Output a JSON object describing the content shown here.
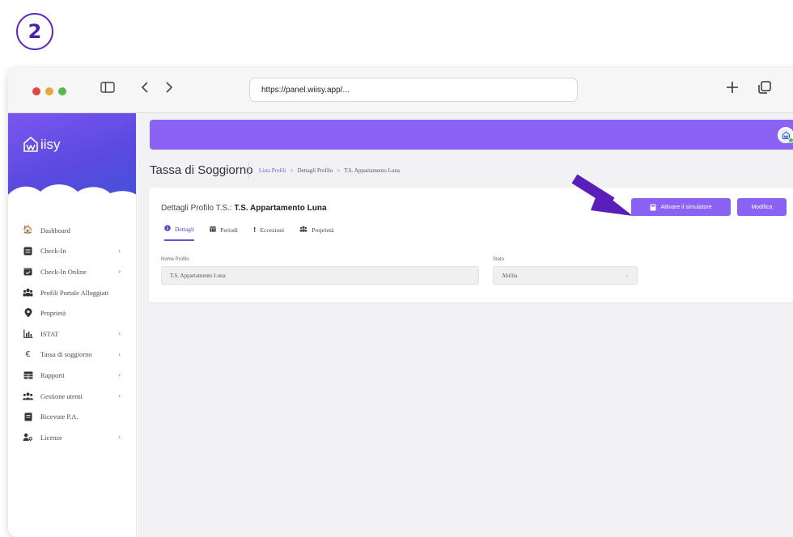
{
  "step": {
    "number": "2"
  },
  "browser": {
    "url": "https://panel.wiisy.app/..."
  },
  "brand": {
    "logo_text": "iisy",
    "accent": "#8a63f5",
    "sidebar_gradient": [
      "#7a57ef",
      "#3f55d8"
    ]
  },
  "sidebar": {
    "items": [
      {
        "label": "Dashboard",
        "icon": "home-icon",
        "chevron": false
      },
      {
        "label": "Check-In",
        "icon": "list-icon",
        "chevron": true
      },
      {
        "label": "Check-In Online",
        "icon": "calendar-check-icon",
        "chevron": true
      },
      {
        "label": "Profili Portale Alloggiati",
        "icon": "users-icon",
        "chevron": false
      },
      {
        "label": "Proprietà",
        "icon": "map-pin-icon",
        "chevron": false
      },
      {
        "label": "ISTAT",
        "icon": "chart-icon",
        "chevron": true
      },
      {
        "label": "Tassa di soggiorno",
        "icon": "euro-icon",
        "chevron": true
      },
      {
        "label": "Rapporti",
        "icon": "table-icon",
        "chevron": true
      },
      {
        "label": "Gestione utenti",
        "icon": "user-group-icon",
        "chevron": true
      },
      {
        "label": "Ricevute P.A.",
        "icon": "receipt-icon",
        "chevron": false
      },
      {
        "label": "Licenze",
        "icon": "user-key-icon",
        "chevron": true
      }
    ]
  },
  "page": {
    "title": "Tassa di Soggiorno",
    "breadcrumb": [
      {
        "label": "Lista Profili",
        "link": true
      },
      {
        "label": "Dettagli Profilo",
        "link": false
      },
      {
        "label": "T.S. Appartamento Luna",
        "link": false
      }
    ],
    "breadcrumb_sep": ">"
  },
  "card": {
    "title_prefix": "Dettagli Profilo T.S.:",
    "title_name": "T.S. Appartamento Luna",
    "btn_simulator": "Attivare il simulatore",
    "btn_edit": "Modifica",
    "tabs": [
      {
        "label": "Dettagli",
        "icon": "info-icon",
        "active": true
      },
      {
        "label": "Periodi",
        "icon": "calendar-icon",
        "active": false
      },
      {
        "label": "Eccezioni",
        "icon": "exclamation-icon",
        "active": false
      },
      {
        "label": "Proprietà",
        "icon": "users-icon",
        "active": false
      }
    ],
    "fields": {
      "name_label": "Nome Profilo",
      "name_value": "T.S. Appartamento Luna",
      "stato_label": "Stato",
      "stato_value": "Abilita"
    }
  }
}
